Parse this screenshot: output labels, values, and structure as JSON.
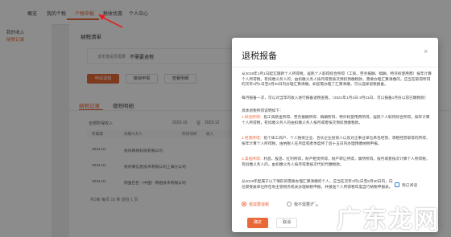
{
  "nav": [
    "概览",
    "我的个税",
    "个税申报",
    "税收优惠",
    "个人中心"
  ],
  "sidebar": [
    "我的收入",
    "纳税记录"
  ],
  "content": {
    "page_title": "纳税清单",
    "notice_prefix": "该年度是否需要",
    "notice_status": "不需要退税",
    "buttons": [
      "申请退税",
      "撤销申报",
      "查看明细"
    ],
    "tabs": [
      "纳税记录",
      "缴税明细"
    ],
    "filter_label": "全部所得收入",
    "filter_year_a": "2023-10",
    "filter_sep": "至",
    "filter_year_b": "2023-12",
    "table_headers": [
      "所属期",
      "扣缴义务人",
      "所得项目",
      "收入",
      "已缴税额"
    ],
    "rows": [
      {
        "period": "2021-01",
        "agent": "杭州网易科技有限公司"
      },
      {
        "period": "2021-01",
        "agent": "杭州某信息技术有限公司上海分公司"
      },
      {
        "period": "2021-01",
        "agent": "阿里巴巴（中国）网络技术有限公司"
      }
    ],
    "pagination": "共3条 每页 10 条 前往 1 页"
  },
  "dialog": {
    "title": "退税报备",
    "close": "×",
    "p1": "从2019年1月1日起实施新个人所得税，居民个人取得综合所得（工资、劳务报酬、稿酬、特许权使用费）按年计算个人所得税，有扣缴义务人的，由扣缴义务人按月或者按次预扣预缴税款，需要办理汇算清缴的，应当在取得所得的次年3月1日至6月30日内办理汇算清缴。如您需办理了汇算清缴，可以选择退税报备。",
    "p2": "每月报备一次，可以对当年的收入进行报备退税查看。（2021年1月1日-3月31日，可以报备1月份以前已缴税款）",
    "p3_title": "具体退税所得说明如下：",
    "p3_items": [
      {
        "tag": "1.综合所得：",
        "text": "指工资薪金所得、劳务报酬所得、稿酬所得、特许权使用费所得，居民个人取得综合所得，按年计算个人所得税，有扣缴义务人的由扣缴义务人按月或者按次预扣预缴税款。"
      },
      {
        "tag": "2.经营所得：",
        "text": "指个体工商户、个人独资企业、合伙企业投资人以及对企事业单位承包经营、承租经营取得的所得，按年计算个人所得税，由纳税人在月度或者季度终了后十五日内办理预缴纳税申报。"
      },
      {
        "tag": "3.其他所得：",
        "text": "利息、股息、红利所得，财产租赁所得，财产转让所得，偶然所得，按月或者按次计算个人所得税，有扣缴义务人的，由扣缴义务人按月或者按次代扣代缴税款。"
      }
    ],
    "p4": "从2019年起属于以下情形的需要办理汇算清缴的个人，应当在次年3月1日至6月30日内，向任职受雇单位所在地主管税务机关办理纳税申报，并报送个人所得税年度自行纳税申报表。",
    "checkbox_label": "我已阅读",
    "radio_1": "我需要退税",
    "radio_2": "我不需要退税",
    "confirm": "确定",
    "cancel": "取消"
  },
  "watermark": "广东龙网"
}
